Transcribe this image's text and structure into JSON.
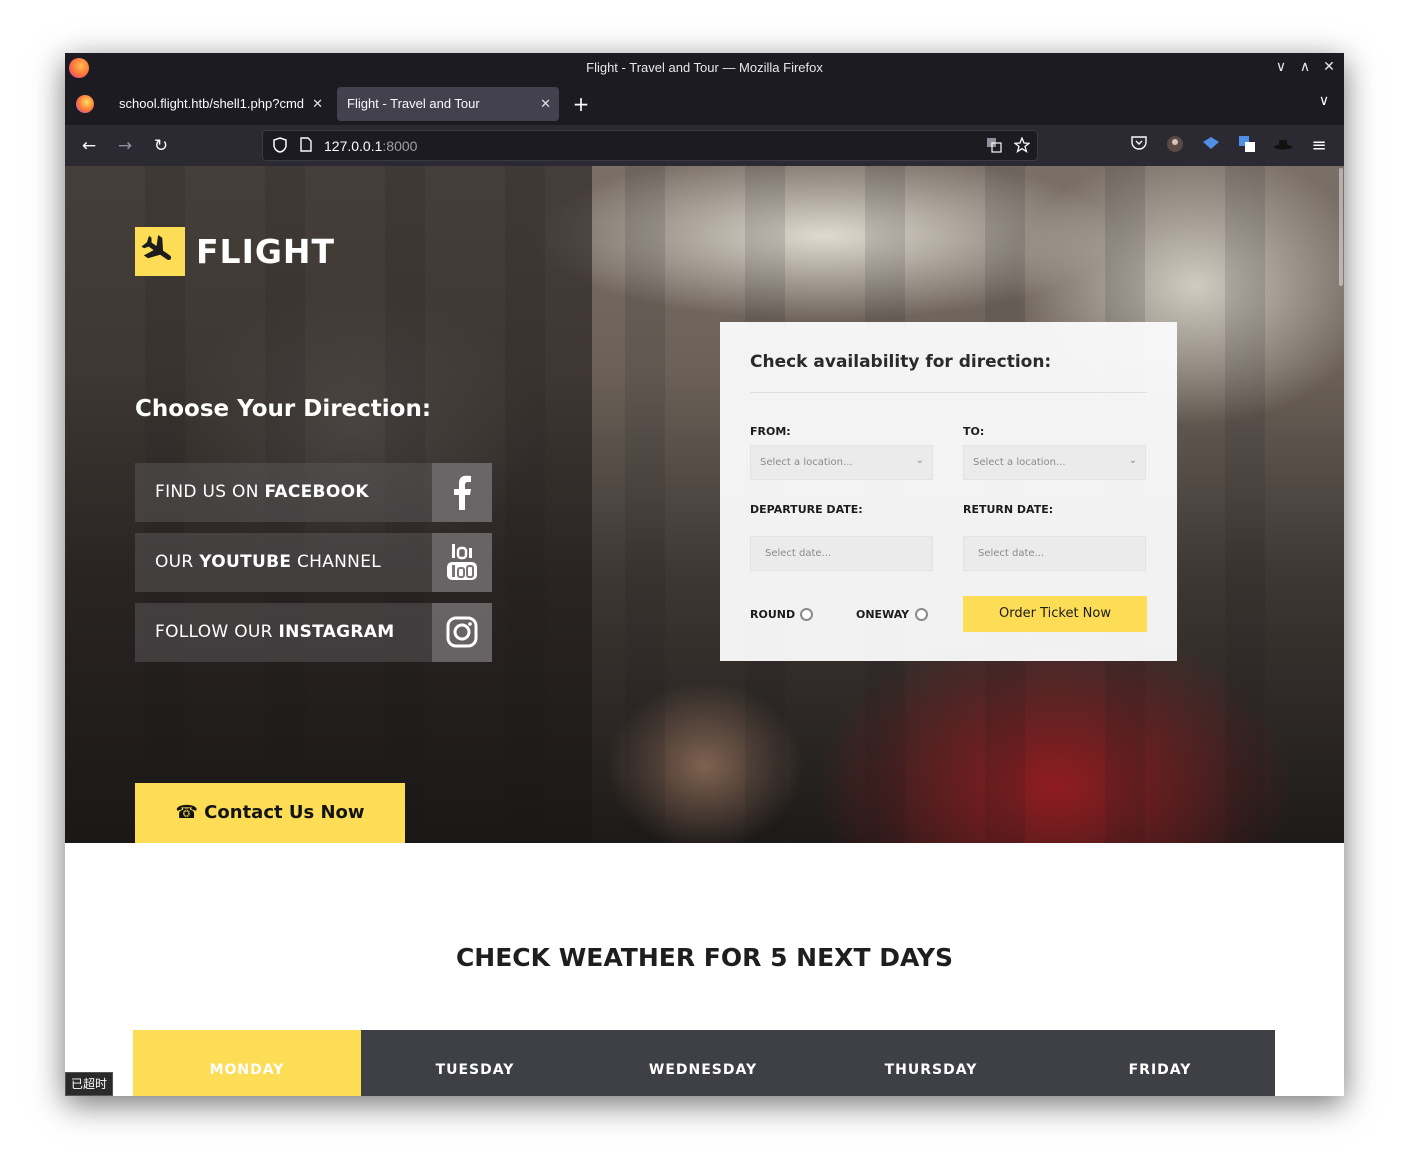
{
  "window": {
    "title": "Flight - Travel and Tour — Mozilla Firefox",
    "controls": {
      "minimize": "∨",
      "maximize": "∧",
      "close": "✕"
    }
  },
  "tabs": [
    {
      "label": "school.flight.htb/shell1.php?cmd",
      "close": "✕"
    },
    {
      "label": "Flight - Travel and Tour",
      "close": "✕"
    }
  ],
  "tabbar": {
    "new_tab": "+",
    "list_all": "∨"
  },
  "navbar": {
    "back": "←",
    "forward": "→",
    "reload": "↻",
    "url_host": "127.0.0.1",
    "url_port": ":8000",
    "menu": "≡"
  },
  "site": {
    "logo_text": "FLIGHT",
    "choose_heading": "Choose Your Direction:",
    "social": [
      {
        "prefix": "FIND US ON ",
        "bold": "FACEBOOK",
        "suffix": ""
      },
      {
        "prefix": "OUR ",
        "bold": "YOUTUBE",
        "suffix": " CHANNEL"
      },
      {
        "prefix": "FOLLOW OUR ",
        "bold": "INSTAGRAM",
        "suffix": ""
      }
    ],
    "contact_button": "Contact Us Now",
    "contact_icon": "☎"
  },
  "booking": {
    "title": "Check availability for direction:",
    "from_label": "FROM:",
    "to_label": "TO:",
    "from_placeholder": "Select a location...",
    "to_placeholder": "Select a location...",
    "departure_label": "DEPARTURE DATE:",
    "return_label": "RETURN DATE:",
    "departure_placeholder": "Select date...",
    "return_placeholder": "Select date...",
    "round_label": "ROUND",
    "oneway_label": "ONEWAY",
    "order_button": "Order Ticket Now"
  },
  "weather": {
    "title": "CHECK WEATHER FOR 5 NEXT DAYS",
    "days": [
      "MONDAY",
      "TUESDAY",
      "WEDNESDAY",
      "THURSDAY",
      "FRIDAY"
    ],
    "active_day": "MONDAY"
  },
  "ime_label": "已超时",
  "colors": {
    "accent": "#fddd56",
    "tab_bar": "#1c1b22",
    "day_bar": "#3e4045"
  }
}
